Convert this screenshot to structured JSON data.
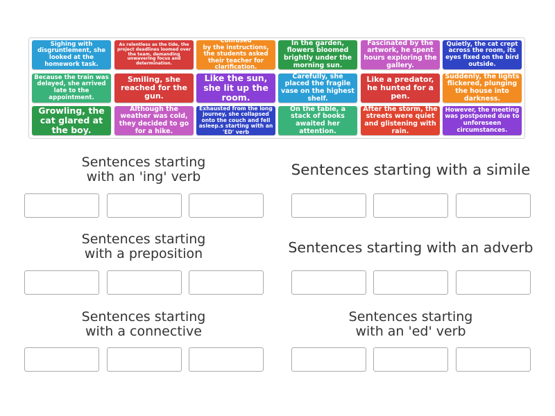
{
  "cards": [
    {
      "text": "Sighing with disgruntlement, she looked at the homework task.",
      "color": "#2b9ed6"
    },
    {
      "text": "As relentless as the tide, the project deadlines loomed over the team, demanding unwavering focus and determination.",
      "color": "#d53c3a"
    },
    {
      "text": "Confused\nby the instructions, the students asked their teacher for clarification.",
      "color": "#f28c22"
    },
    {
      "text": "In the garden, flowers bloomed brightly under the morning sun.",
      "color": "#2d9a49"
    },
    {
      "text": "Fascinated by the artwork, he spent hours exploring the gallery.",
      "color": "#c45cc4"
    },
    {
      "text": "Quietly, the cat crept across the room, its eyes fixed on the bird outside.",
      "color": "#2f43c5"
    },
    {
      "text": "Because the train was delayed, she arrived late to the appointment.",
      "color": "#3ab37a"
    },
    {
      "text": "Smiling, she reached for the gun.",
      "color": "#d53c3a"
    },
    {
      "text": "Like the sun, she lit up the room.",
      "color": "#8a3fd6"
    },
    {
      "text": "Carefully, she placed the fragile vase on the highest shelf.",
      "color": "#2b9ed6"
    },
    {
      "text": "Like a predator, he hunted for a pen.",
      "color": "#d53c3a"
    },
    {
      "text": "Suddenly, the lights flickered, plunging the house into darkness.",
      "color": "#f28c22"
    },
    {
      "text": "Growling, the cat glared at the boy.",
      "color": "#2d9a49"
    },
    {
      "text": "Although the weather was cold, they decided to go for a hike.",
      "color": "#c45cc4"
    },
    {
      "text": "Exhausted from the long journey, she collapsed onto the couch and fell asleep.s starting with an 'ED' verb",
      "color": "#2f43c5"
    },
    {
      "text": "On the table, a stack of books awaited her attention.",
      "color": "#3ab37a"
    },
    {
      "text": "After the storm, the streets were quiet and glistening with rain.",
      "color": "#e0432f"
    },
    {
      "text": "However, the meeting was postponed due to unforeseen circumstances.",
      "color": "#8a3fd6"
    }
  ],
  "groups": [
    {
      "heading": "Sentences starting\nwith an 'ing' verb"
    },
    {
      "heading": "Sentences starting with a simile"
    },
    {
      "heading": "Sentences starting\nwith a preposition"
    },
    {
      "heading": "Sentences starting with an adverb"
    },
    {
      "heading": "Sentences starting\nwith a connective"
    },
    {
      "heading": "Sentences starting\nwith an 'ed' verb"
    }
  ]
}
